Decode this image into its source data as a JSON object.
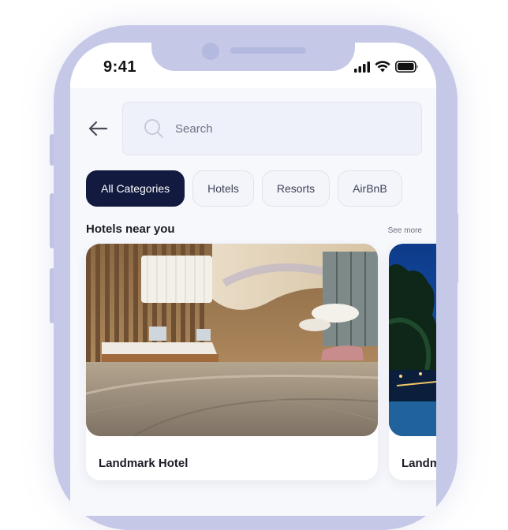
{
  "status_bar": {
    "time": "9:41"
  },
  "search": {
    "placeholder": "Search"
  },
  "categories": [
    {
      "label": "All Categories",
      "active": true
    },
    {
      "label": "Hotels",
      "active": false
    },
    {
      "label": "Resorts",
      "active": false
    },
    {
      "label": "AirBnB",
      "active": false
    }
  ],
  "section": {
    "title": "Hotels near you",
    "see_more": "See more"
  },
  "hotels": [
    {
      "name": "Landmark Hotel",
      "image": "hotel-lobby-photo"
    },
    {
      "name": "Landmark Hotel",
      "image": "resort-night-photo"
    }
  ],
  "colors": {
    "frame": "#c5c9e7",
    "active_chip": "#121a40",
    "screen_bg": "#f7f8fc"
  },
  "icons": [
    "back-arrow-icon",
    "search-icon",
    "signal-icon",
    "wifi-icon",
    "battery-icon"
  ]
}
